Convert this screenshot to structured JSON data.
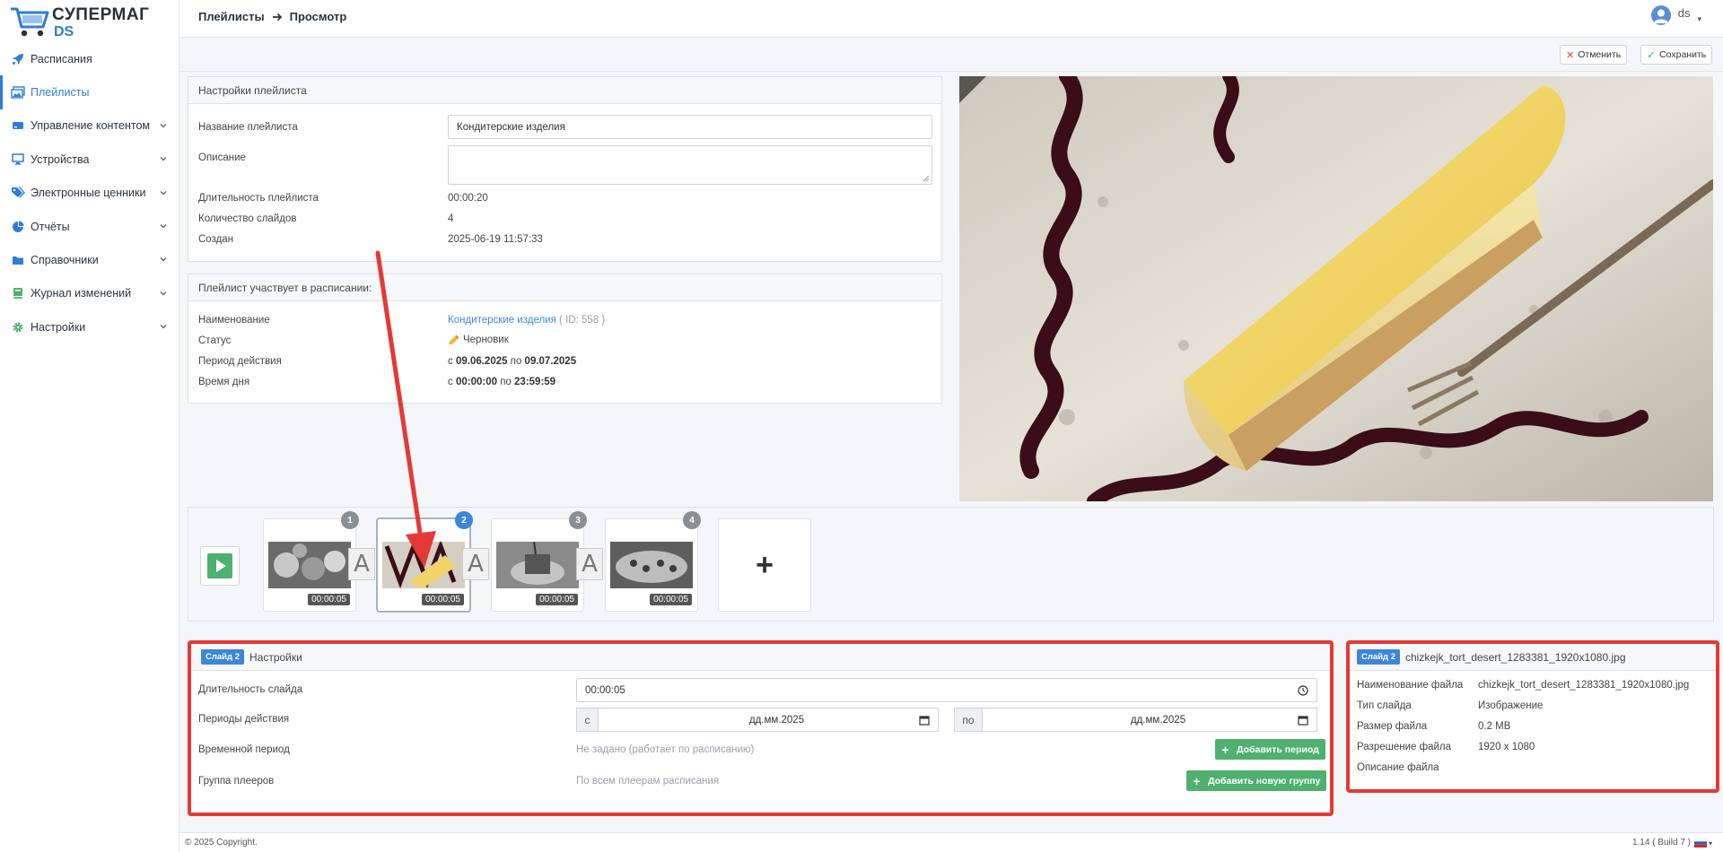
{
  "brand": {
    "line1": "СУПЕРМАГ",
    "line2": "DS"
  },
  "sidebar": {
    "items": [
      {
        "label": "Расписания",
        "icon": "rocket-icon",
        "chevron": false
      },
      {
        "label": "Плейлисты",
        "icon": "images-icon",
        "chevron": false,
        "active": true
      },
      {
        "label": "Управление контентом",
        "icon": "server-icon",
        "chevron": true
      },
      {
        "label": "Устройства",
        "icon": "monitor-icon",
        "chevron": true
      },
      {
        "label": "Электронные ценники",
        "icon": "tags-icon",
        "chevron": true
      },
      {
        "label": "Отчёты",
        "icon": "pie-chart-icon",
        "chevron": true
      },
      {
        "label": "Справочники",
        "icon": "folder-icon",
        "chevron": true
      },
      {
        "label": "Журнал изменений",
        "icon": "book-icon",
        "chevron": true
      },
      {
        "label": "Настройки",
        "icon": "gear-icon",
        "chevron": true
      }
    ]
  },
  "header": {
    "crumb1": "Плейлисты",
    "crumb2": "Просмотр",
    "user": "ds"
  },
  "toolbar": {
    "cancel_label": "Отменить",
    "save_label": "Сохранить"
  },
  "playlist_settings": {
    "title": "Настройки плейлиста",
    "name_label": "Название плейлиста",
    "name_value": "Кондитерские изделия",
    "description_label": "Описание",
    "duration_label": "Длительность плейлиста",
    "duration_value": "00:00:20",
    "slides_count_label": "Количество слайдов",
    "slides_count_value": "4",
    "created_label": "Создан",
    "created_value": "2025-06-19 11:57:33"
  },
  "schedule": {
    "title": "Плейлист участвует в расписании:",
    "name_label": "Наименование",
    "name_link": "Кондитерские изделия",
    "name_id": "( ID: 558 )",
    "status_label": "Статус",
    "status_value": "Черновик",
    "period_label": "Период действия",
    "period_from_prefix": "с",
    "period_from": "09.06.2025",
    "period_to_prefix": "по",
    "period_to": "09.07.2025",
    "time_label": "Время дня",
    "time_from_prefix": "с",
    "time_from": "00:00:00",
    "time_to_prefix": "по",
    "time_to": "23:59:59"
  },
  "timeline": {
    "slides": [
      {
        "num": "1",
        "time": "00:00:05"
      },
      {
        "num": "2",
        "time": "00:00:05",
        "selected": true
      },
      {
        "num": "3",
        "time": "00:00:05"
      },
      {
        "num": "4",
        "time": "00:00:05"
      }
    ],
    "transition_glyph": "A",
    "add_glyph": "+"
  },
  "slide_settings": {
    "badge": "Слайд 2",
    "title": "Настройки",
    "duration_label": "Длительность слайда",
    "duration_value": "00:00:05",
    "periods_label": "Периоды действия",
    "from_prefix": "с",
    "to_prefix": "по",
    "date_placeholder": "дд.мм.2025",
    "time_period_label": "Временной период",
    "time_period_value": "Не задано (работает по расписанию)",
    "add_period_label": "Добавить период",
    "group_label": "Группа плееров",
    "group_value": "По всем плеерам расписания",
    "add_group_label": "Добавить новую группу"
  },
  "file_info": {
    "badge": "Слайд 2",
    "title": "chizkejk_tort_desert_1283381_1920x1080.jpg",
    "filename_label": "Наименование файла",
    "filename_value": "chizkejk_tort_desert_1283381_1920x1080.jpg",
    "type_label": "Тип слайда",
    "type_value": "Изображение",
    "size_label": "Размер файла",
    "size_value": "0.2 MB",
    "resolution_label": "Разрешение файла",
    "resolution_value": "1920 x 1080",
    "description_label": "Описание файла"
  },
  "footer": {
    "copyright": "© 2025 Copyright.",
    "version": "1.14 ( Build 7 )"
  },
  "colors": {
    "accent": "#3d86d8",
    "success": "#4fb06f",
    "danger": "#e53935"
  }
}
